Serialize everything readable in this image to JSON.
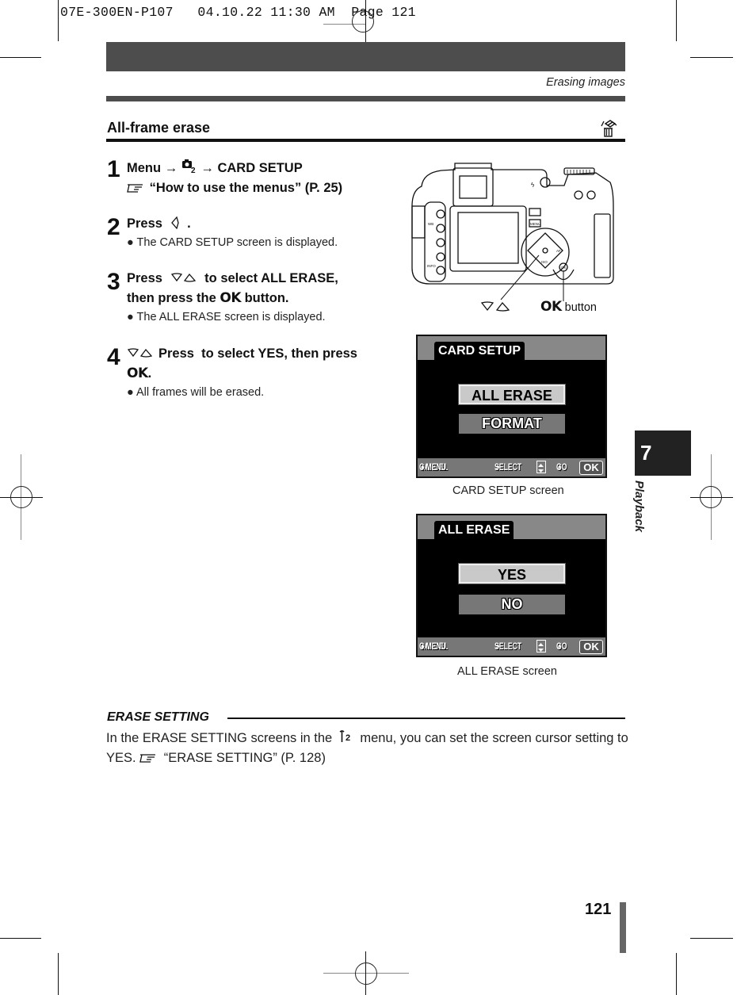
{
  "slug": "07E-300EN-P107   04.10.22 11:30 AM  Page 121",
  "running_header": "Erasing images",
  "section": {
    "title": "All-frame erase",
    "icon": "erase-all-icon"
  },
  "steps": [
    {
      "number": "1",
      "line1": {
        "menu": "Menu",
        "arrow": "→",
        "icon": "camera-2-icon",
        "icon_sub": "2",
        "arrow2": "→",
        "target": "CARD SETUP"
      },
      "line2": {
        "ref_icon": "reference-hand-icon",
        "text": "“How to use the menus” (P. 25)"
      }
    },
    {
      "number": "2",
      "text_a": "Press",
      "icon": "arrow-left-icon",
      "text_b": ".",
      "bullet": "The CARD SETUP screen is displayed."
    },
    {
      "number": "3",
      "text_a": "Press",
      "icon": "arrow-down-up-icon",
      "text_b": "to select ALL ERASE,",
      "text_c": "then press the",
      "ok": "OK",
      "text_d": "button.",
      "bullet": "The ALL ERASE screen is displayed."
    },
    {
      "number": "4",
      "icon": "arrow-down-up-icon",
      "text_a": "Press  to select YES, then press",
      "ok": "OK",
      "text_b": ".",
      "bullet": "All frames will be erased."
    }
  ],
  "camera_figure": {
    "callout_arrows": "arrow-down-up-icon",
    "callout_ok": "OK",
    "callout_ok_suffix": "button",
    "body_labels": {
      "menu": "MENU",
      "af": "AF",
      "iso": "ISO",
      "wb": "WB",
      "info": "INFO",
      "ok": "OK"
    }
  },
  "screens": [
    {
      "tab": "CARD SETUP",
      "options": [
        {
          "label": "ALL ERASE",
          "selected": true
        },
        {
          "label": "FORMAT",
          "selected": false
        }
      ],
      "footer": {
        "cancel": "CANCEL",
        "cancel_target": "MENU",
        "select": "SELECT",
        "go": "GO",
        "ok": "OK"
      },
      "caption": "CARD SETUP screen"
    },
    {
      "tab": "ALL ERASE",
      "options": [
        {
          "label": "YES",
          "selected": true
        },
        {
          "label": "NO",
          "selected": false
        }
      ],
      "footer": {
        "cancel": "CANCEL",
        "cancel_target": "MENU",
        "select": "SELECT",
        "go": "GO",
        "ok": "OK"
      },
      "caption": "ALL ERASE screen"
    }
  ],
  "chapter_tab": {
    "number": "7",
    "label": "Playback"
  },
  "note": {
    "heading": "ERASE SETTING",
    "body_a": "In the ERASE SETTING screens in the",
    "menu_icon": "setup-2-icon",
    "menu_icon_sub": "2",
    "body_b": "menu, you can set the screen cursor setting to YES.",
    "ref_icon": "reference-hand-icon",
    "body_c": "“ERASE SETTING” (P. 128)"
  },
  "page_number": "121",
  "colors": {
    "band": "#4d4d4d",
    "tab": "#222222",
    "lcd_gray": "#888888",
    "lcd_selected": "#c9c9c9"
  }
}
